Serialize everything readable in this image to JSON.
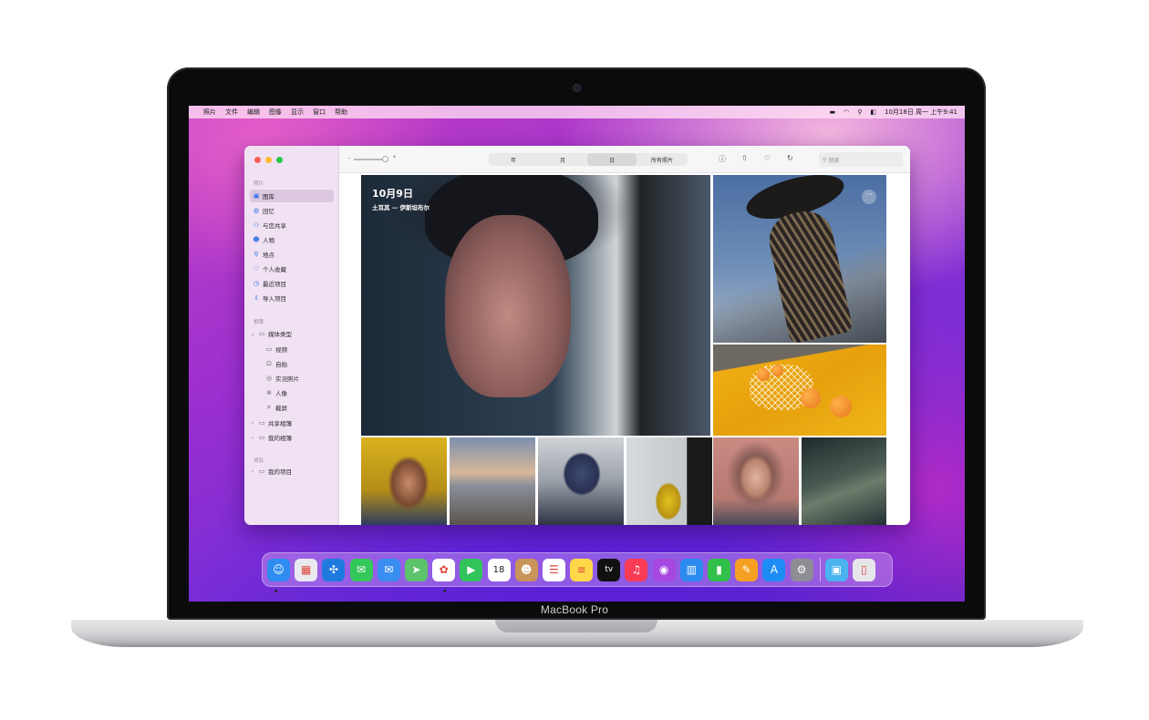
{
  "device": {
    "label": "MacBook Pro"
  },
  "menubar": {
    "apple_icon": "apple-logo-icon",
    "items": [
      "照片",
      "文件",
      "编辑",
      "图像",
      "显示",
      "窗口",
      "帮助"
    ],
    "status_icons": [
      "battery-icon",
      "wifi-icon",
      "search-icon",
      "control-center-icon"
    ],
    "clock": "10月18日 周一 上午9:41"
  },
  "window": {
    "sidebar": {
      "section_photos": "照片",
      "items": [
        {
          "label": "图库",
          "icon": "photo-library-icon",
          "selected": true
        },
        {
          "label": "回忆",
          "icon": "memories-icon"
        },
        {
          "label": "与您共享",
          "icon": "shared-with-you-icon"
        },
        {
          "label": "人物",
          "icon": "people-icon"
        },
        {
          "label": "地点",
          "icon": "places-icon"
        },
        {
          "label": "个人收藏",
          "icon": "heart-icon"
        },
        {
          "label": "最近项目",
          "icon": "clock-icon"
        },
        {
          "label": "导入项目",
          "icon": "import-icon"
        }
      ],
      "section_albums": "相簿",
      "albums": [
        {
          "label": "媒体类型",
          "icon": "folder-icon",
          "expanded": true
        },
        {
          "label": "视频",
          "icon": "video-icon"
        },
        {
          "label": "自拍",
          "icon": "selfie-icon"
        },
        {
          "label": "实况照片",
          "icon": "live-photo-icon"
        },
        {
          "label": "人像",
          "icon": "portrait-icon"
        },
        {
          "label": "截屏",
          "icon": "screenshot-icon"
        },
        {
          "label": "共享相簿",
          "icon": "folder-icon"
        },
        {
          "label": "我的相簿",
          "icon": "folder-icon"
        }
      ],
      "section_projects": "项目",
      "projects": [
        {
          "label": "我的项目",
          "icon": "folder-icon"
        }
      ]
    },
    "toolbar": {
      "view_tabs": [
        "年",
        "月",
        "日",
        "所有照片"
      ],
      "active_tab": "日",
      "icons": [
        "info-icon",
        "share-icon",
        "favorite-icon",
        "rotate-icon"
      ],
      "search_placeholder": "搜索"
    },
    "grid": {
      "hero_date": "10月9日",
      "hero_location": "土耳其 — 伊斯坦布尔"
    }
  },
  "dock": {
    "apps": [
      {
        "name": "finder-icon",
        "color": "#2f8cf0",
        "glyph": "☺"
      },
      {
        "name": "launchpad-icon",
        "color": "#e9e9ef",
        "glyph": "▦"
      },
      {
        "name": "safari-icon",
        "color": "#1f7ae0",
        "glyph": "✣"
      },
      {
        "name": "messages-icon",
        "color": "#34c759",
        "glyph": "✉"
      },
      {
        "name": "mail-icon",
        "color": "#3a8ef0",
        "glyph": "✉"
      },
      {
        "name": "maps-icon",
        "color": "#5cc36a",
        "glyph": "➤"
      },
      {
        "name": "photos-icon",
        "color": "#ffffff",
        "glyph": "✿"
      },
      {
        "name": "facetime-icon",
        "color": "#30c45a",
        "glyph": "▶"
      },
      {
        "name": "calendar-icon",
        "color": "#ffffff",
        "glyph": "18"
      },
      {
        "name": "contacts-icon",
        "color": "#c8945a",
        "glyph": "☻"
      },
      {
        "name": "reminders-icon",
        "color": "#ffffff",
        "glyph": "☰"
      },
      {
        "name": "notes-icon",
        "color": "#ffd84a",
        "glyph": "≡"
      },
      {
        "name": "tv-icon",
        "color": "#111111",
        "glyph": "tv"
      },
      {
        "name": "music-icon",
        "color": "#fa3b55",
        "glyph": "♫"
      },
      {
        "name": "podcasts-icon",
        "color": "#a648e0",
        "glyph": "◉"
      },
      {
        "name": "keynote-icon",
        "color": "#2a8af0",
        "glyph": "▥"
      },
      {
        "name": "numbers-icon",
        "color": "#31c04a",
        "glyph": "▮"
      },
      {
        "name": "pages-icon",
        "color": "#f5a023",
        "glyph": "✎"
      },
      {
        "name": "app-store-icon",
        "color": "#1d8df5",
        "glyph": "A"
      },
      {
        "name": "system-preferences-icon",
        "color": "#8d8d93",
        "glyph": "⚙"
      }
    ],
    "extras": [
      {
        "name": "downloads-folder-icon",
        "color": "#49b4f0",
        "glyph": "▣"
      },
      {
        "name": "trash-icon",
        "color": "#e6e6ea",
        "glyph": "▯"
      }
    ]
  }
}
